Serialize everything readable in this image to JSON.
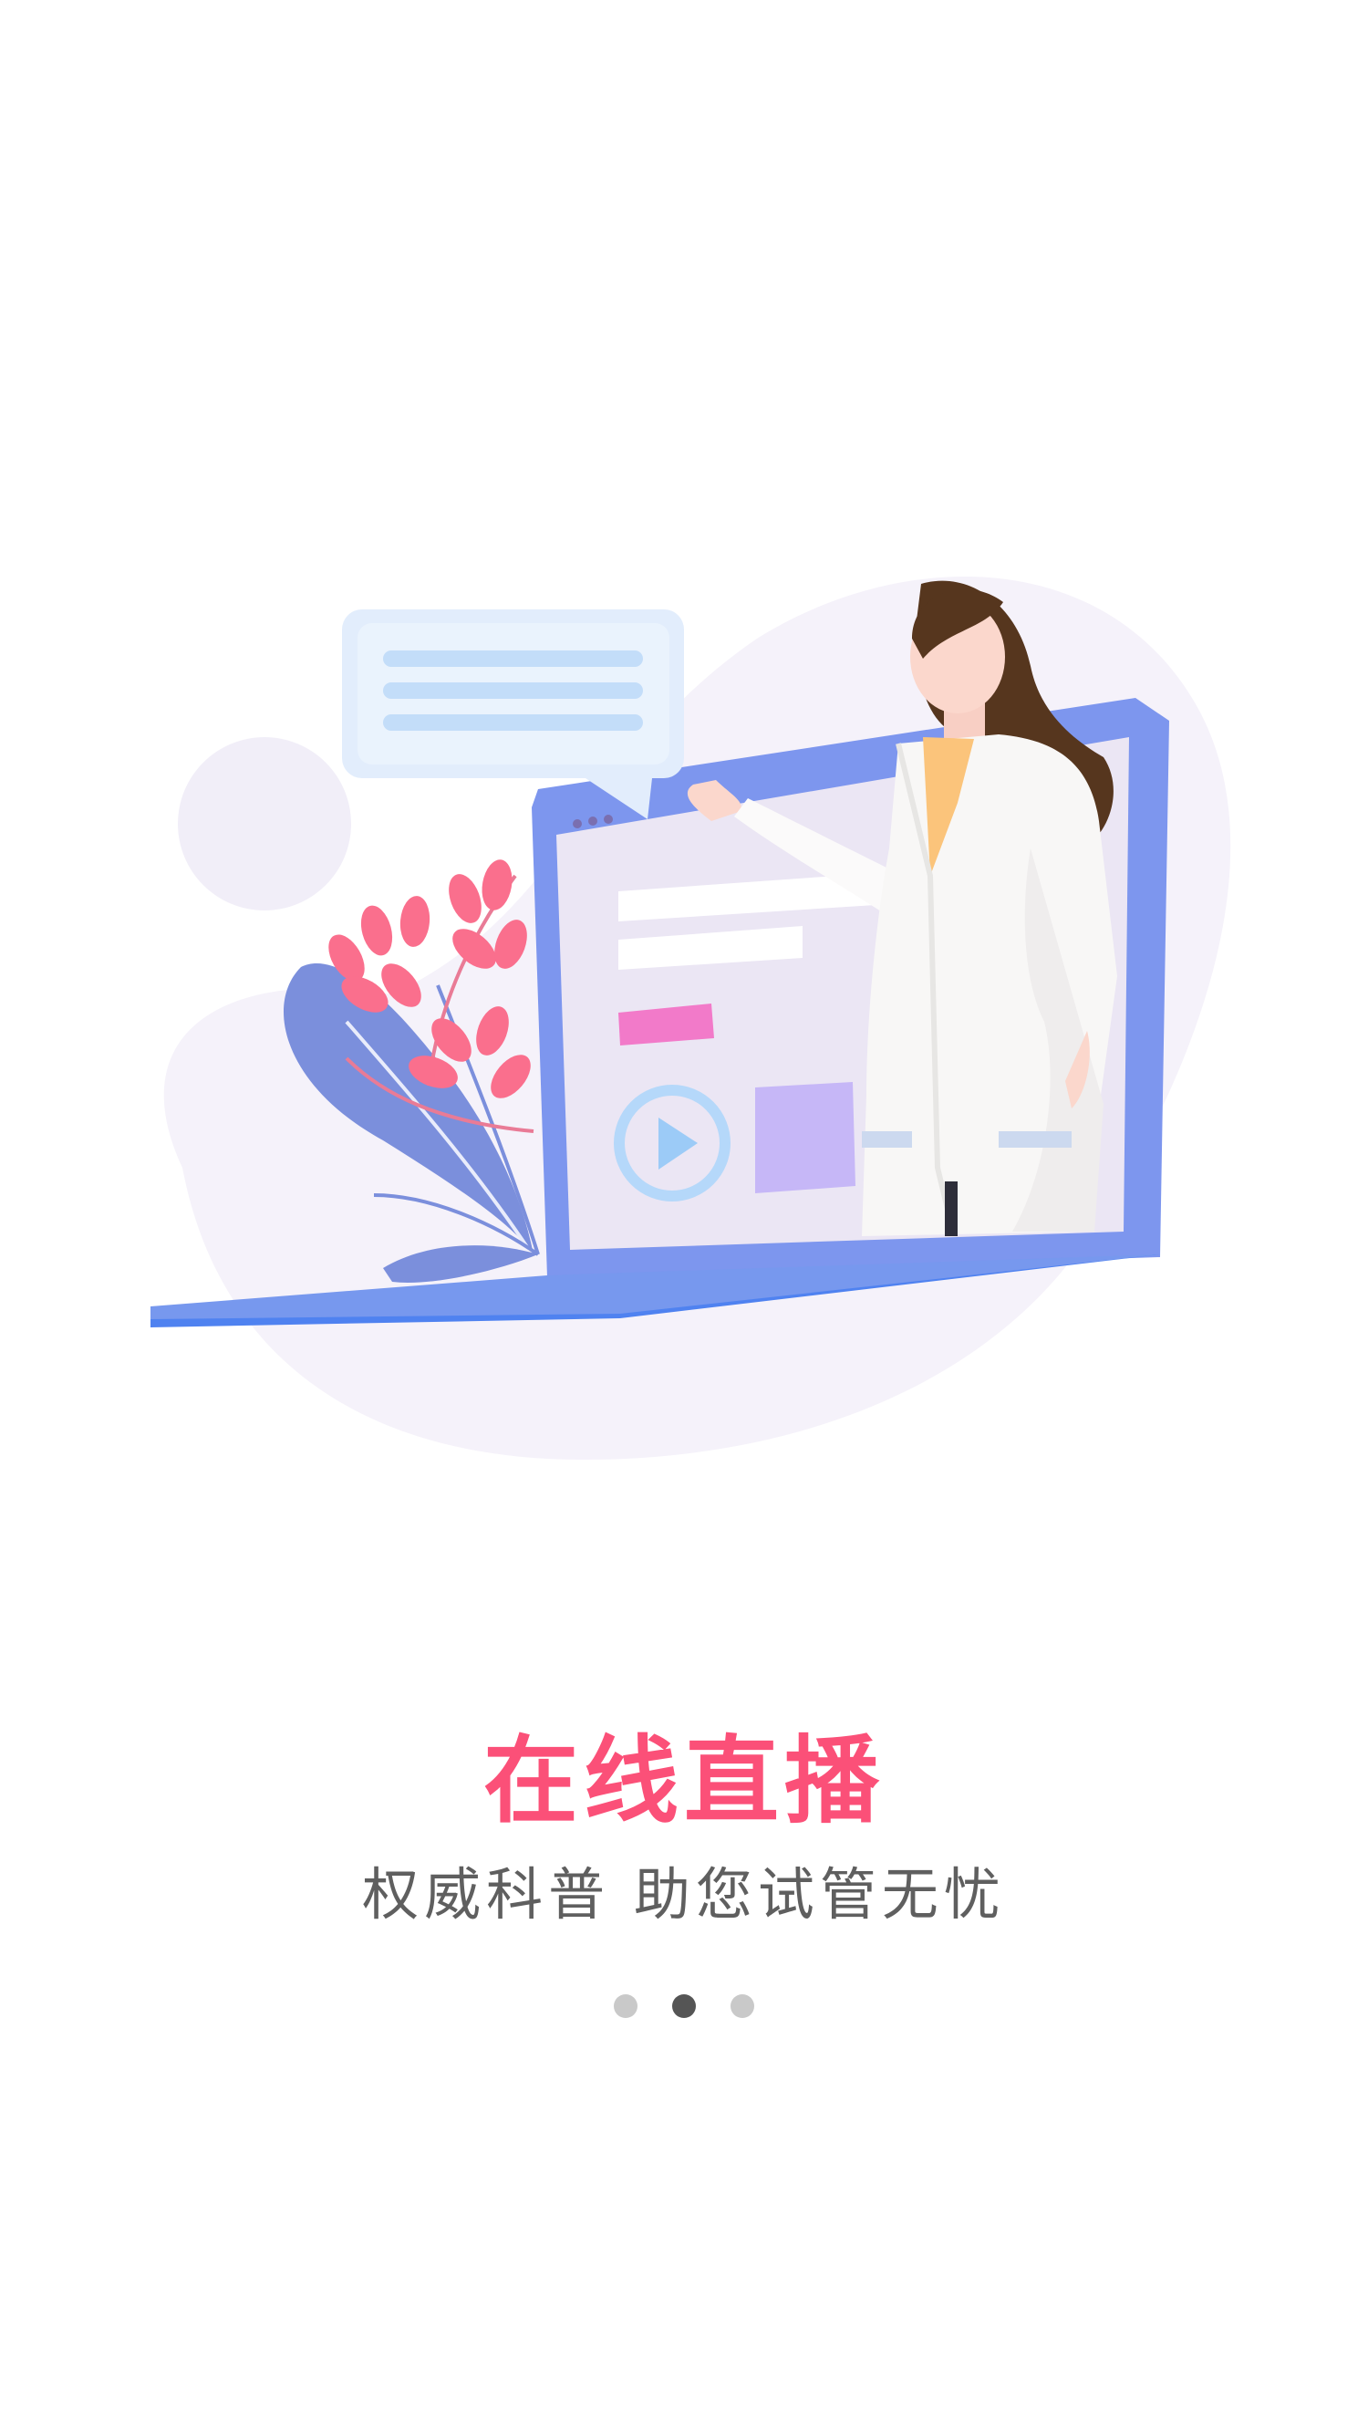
{
  "onboarding": {
    "title": "在线直播",
    "subtitle": "权威科普 助您试管无忧",
    "page_count": 3,
    "current_page": 2
  },
  "illustration": {
    "subject": "doctor presenting next to a laptop with a video player",
    "icons": [
      "speech-bubble-icon",
      "play-icon",
      "leaf-plant-icon"
    ]
  },
  "colors": {
    "title": "#fb5078",
    "subtitle": "#5f5f5f",
    "dot_inactive": "#c9c9c9",
    "dot_active": "#555555",
    "laptop_frame": "#8099ee",
    "background_blob": "#f5f2fa"
  }
}
